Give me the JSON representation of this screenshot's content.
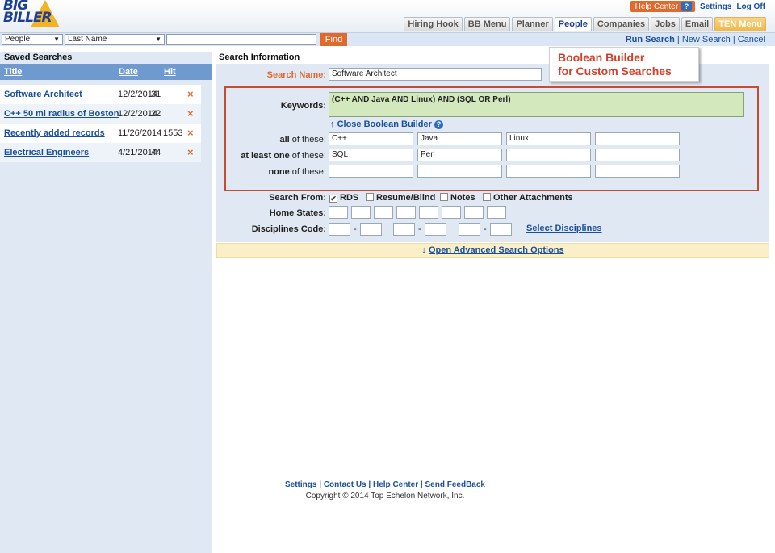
{
  "app": {
    "logo_text_line1": "BIG",
    "logo_text_line2": "BILLER"
  },
  "top_links": {
    "help_center": "Help Center",
    "settings": "Settings",
    "log_off": "Log Off"
  },
  "tabs": [
    "Hiring Hook",
    "BB Menu",
    "Planner",
    "People",
    "Companies",
    "Jobs",
    "Email",
    "TEN Menu"
  ],
  "search_bar": {
    "category": "People",
    "field": "Last Name",
    "query": "",
    "find_label": "Find",
    "run_search": "Run Search",
    "new_search": "New Search",
    "cancel": "Cancel",
    "separator": "|"
  },
  "sidebar": {
    "title": "Saved Searches",
    "columns": [
      "Title",
      "Date",
      "Hit"
    ],
    "rows": [
      {
        "title": "Software Architect",
        "date": "12/2/2014",
        "hits": "31"
      },
      {
        "title": "C++ 50 mi radius of Boston",
        "date": "12/2/2014",
        "hits": "22"
      },
      {
        "title": "Recently added records",
        "date": "11/26/2014",
        "hits": "1553"
      },
      {
        "title": "Electrical Engineers",
        "date": "4/21/2014",
        "hits": "44"
      }
    ],
    "delete_glyph": "×"
  },
  "main": {
    "title": "Search Information",
    "search_name_label": "Search Name:",
    "search_name_value": "Software Architect",
    "callout": {
      "line1": "Boolean Builder",
      "line2": "for Custom Searches"
    },
    "keywords_label": "Keywords:",
    "keywords_value": "(C++ AND Java AND Linux) AND (SQL OR Perl)",
    "close_builder": "Close Boolean Builder",
    "all_label_bold": "all",
    "all_label_rest": " of these:",
    "atleast_label_bold": "at least one",
    "atleast_label_rest": " of these:",
    "none_label_bold": "none",
    "none_label_rest": " of these:",
    "all_values": [
      "C++",
      "Java",
      "Linux",
      ""
    ],
    "atleast_values": [
      "SQL",
      "Perl",
      "",
      ""
    ],
    "none_values": [
      "",
      "",
      "",
      ""
    ],
    "search_from_label": "Search From:",
    "search_from_options": [
      {
        "label": "RDS",
        "checked": true
      },
      {
        "label": "Resume/Blind",
        "checked": false
      },
      {
        "label": "Notes",
        "checked": false
      },
      {
        "label": "Other Attachments",
        "checked": false
      }
    ],
    "home_states_label": "Home States:",
    "disciplines_label": "Disciplines Code:",
    "disciplines_dash": "-",
    "select_disciplines": "Select Disciplines",
    "advanced_options": "Open Advanced Search Options"
  },
  "footer": {
    "links": [
      "Settings",
      "Contact Us",
      "Help Center",
      "Send FeedBack"
    ],
    "separator": "|",
    "copyright": "Copyright © 2014 Top Echelon Network, Inc."
  },
  "colors": {
    "accent_orange": "#e0692e",
    "link_blue": "#1a4f9c",
    "panel_blue": "#e0e8f3",
    "header_blue": "#6e9ad0",
    "callout_red": "#d6402a"
  }
}
